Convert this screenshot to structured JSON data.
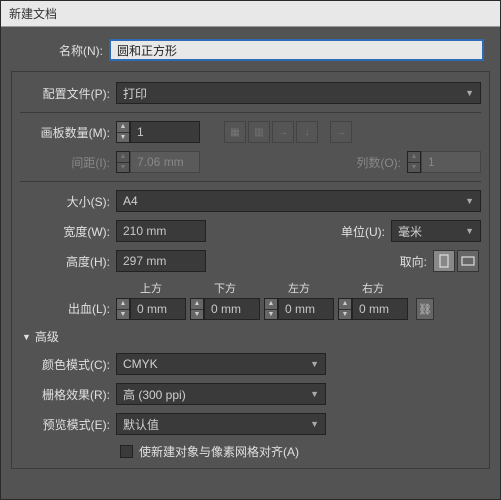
{
  "window": {
    "title": "新建文档"
  },
  "name": {
    "label": "名称(N):",
    "value": "圆和正方形"
  },
  "profile": {
    "label": "配置文件(P):",
    "value": "打印"
  },
  "artboards": {
    "count_label": "画板数量(M):",
    "count_value": "1",
    "spacing_label": "间距(I):",
    "spacing_value": "7.06 mm",
    "cols_label": "列数(O):",
    "cols_value": "1"
  },
  "size": {
    "preset_label": "大小(S):",
    "preset_value": "A4",
    "width_label": "宽度(W):",
    "width_value": "210 mm",
    "height_label": "高度(H):",
    "height_value": "297 mm",
    "unit_label": "单位(U):",
    "unit_value": "毫米",
    "orient_label": "取向:"
  },
  "bleed": {
    "label": "出血(L):",
    "top_label": "上方",
    "top_value": "0 mm",
    "bottom_label": "下方",
    "bottom_value": "0 mm",
    "left_label": "左方",
    "left_value": "0 mm",
    "right_label": "右方",
    "right_value": "0 mm"
  },
  "advanced": {
    "header": "高级",
    "color_label": "颜色模式(C):",
    "color_value": "CMYK",
    "raster_label": "栅格效果(R):",
    "raster_value": "高 (300 ppi)",
    "preview_label": "预览模式(E):",
    "preview_value": "默认值",
    "align_label": "使新建对象与像素网格对齐(A)"
  }
}
